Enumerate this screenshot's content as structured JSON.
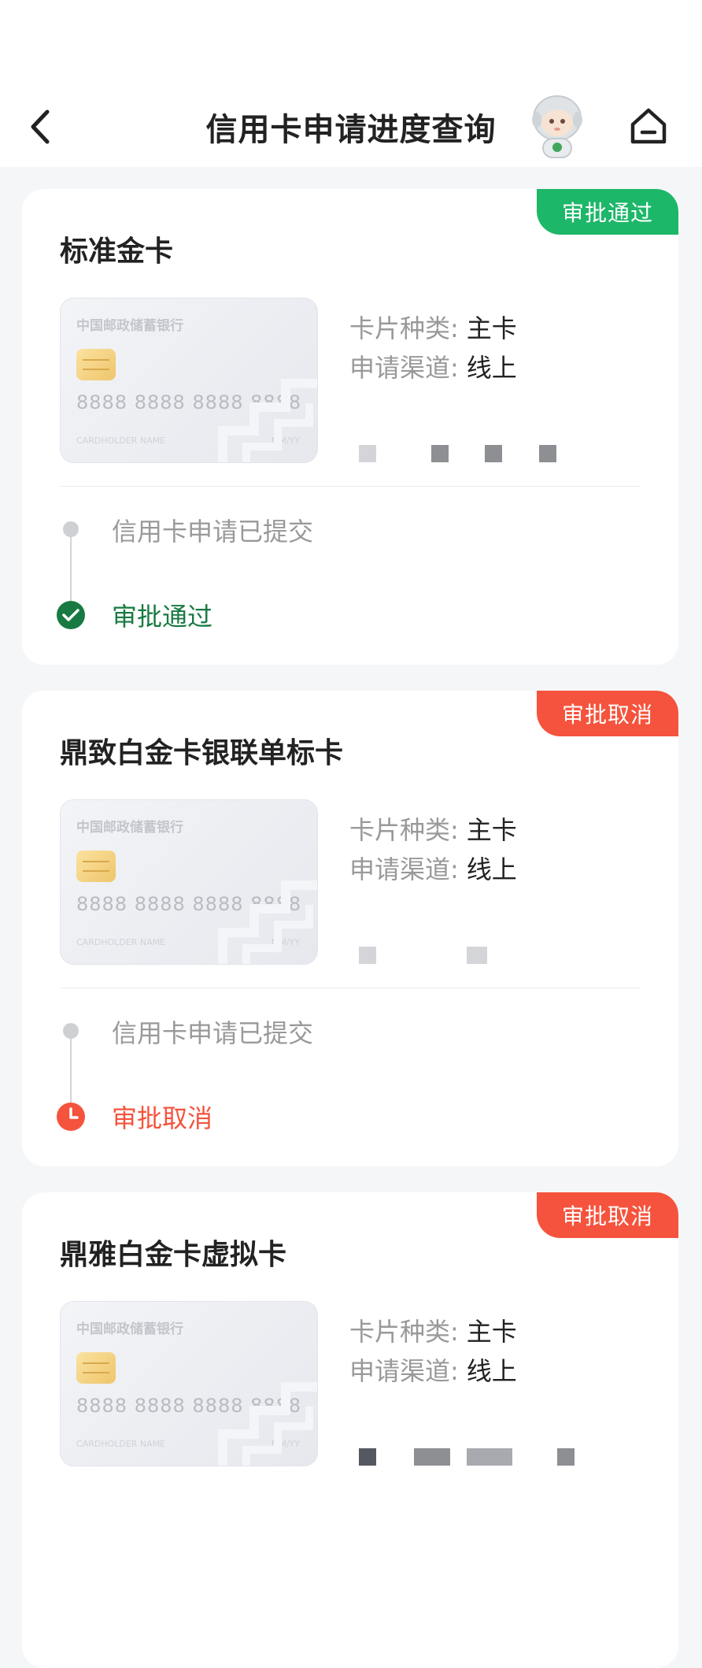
{
  "header": {
    "title": "信用卡申请进度查询"
  },
  "colors": {
    "approved": "#1db769",
    "approved_text": "#187a42",
    "cancelled": "#f5533d"
  },
  "card_visual": {
    "bank_name": "中国邮政储蓄银行",
    "number": "8888 8888 8888 8888",
    "holder": "CARDHOLDER NAME",
    "expiry": "MM/YY"
  },
  "labels": {
    "type_label": "卡片种类:",
    "channel_label": "申请渠道:"
  },
  "applications": [
    {
      "name": "标准金卡",
      "badge": "审批通过",
      "status": "approved",
      "card_type": "主卡",
      "channel": "线上",
      "step_submitted": "信用卡申请已提交",
      "step_result": "审批通过"
    },
    {
      "name": "鼎致白金卡银联单标卡",
      "badge": "审批取消",
      "status": "cancelled",
      "card_type": "主卡",
      "channel": "线上",
      "step_submitted": "信用卡申请已提交",
      "step_result": "审批取消"
    },
    {
      "name": "鼎雅白金卡虚拟卡",
      "badge": "审批取消",
      "status": "cancelled",
      "card_type": "主卡",
      "channel": "线上"
    }
  ]
}
